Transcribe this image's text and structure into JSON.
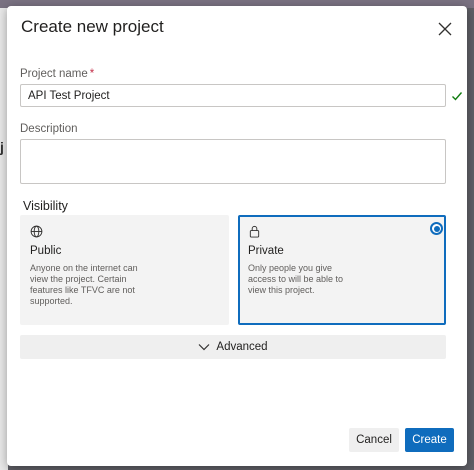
{
  "backdrop": {
    "partial_text": "j"
  },
  "dialog": {
    "title": "Create new project",
    "close_icon": "close-icon",
    "project_name": {
      "label": "Project name",
      "required_marker": "*",
      "value": "API Test Project",
      "valid_icon": "checkmark-icon"
    },
    "description": {
      "label": "Description",
      "value": ""
    },
    "visibility": {
      "label": "Visibility",
      "options": [
        {
          "icon": "globe-icon",
          "title": "Public",
          "description": "Anyone on the internet can view the project. Certain features like TFVC are not supported.",
          "selected": false
        },
        {
          "icon": "lock-icon",
          "title": "Private",
          "description": "Only people you give access to will be able to view this project.",
          "selected": true
        }
      ]
    },
    "advanced": {
      "label": "Advanced",
      "icon": "chevron-down-icon"
    },
    "buttons": {
      "cancel": "Cancel",
      "create": "Create"
    }
  },
  "colors": {
    "accent": "#0f6cbd",
    "required": "#c4314b",
    "valid": "#107c10"
  }
}
